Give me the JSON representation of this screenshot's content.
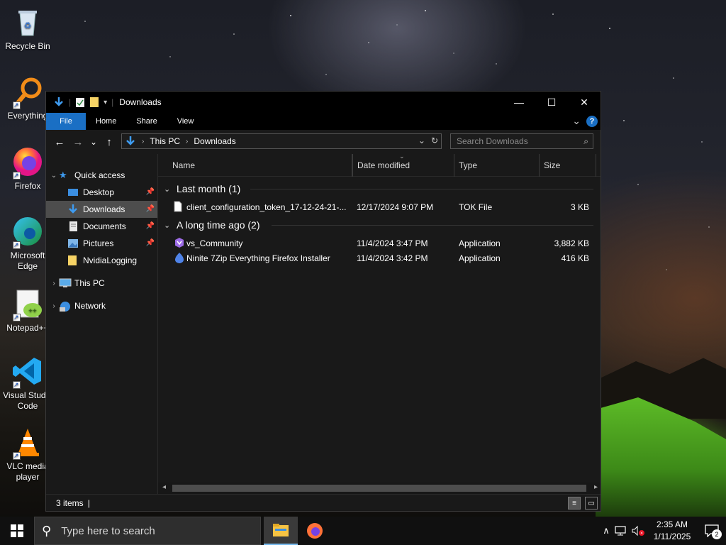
{
  "desktop": {
    "icons": [
      {
        "label": "Recycle Bin",
        "icon": "recycle-bin-icon"
      },
      {
        "label": "Everything",
        "icon": "everything-search-icon"
      },
      {
        "label": "Firefox",
        "icon": "firefox-icon"
      },
      {
        "label": "Microsoft\nEdge",
        "icon": "edge-icon"
      },
      {
        "label": "Notepad++",
        "icon": "notepad-plus-plus-icon"
      },
      {
        "label": "Visual Studio\nCode",
        "icon": "vscode-icon"
      },
      {
        "label": "VLC media\nplayer",
        "icon": "vlc-icon"
      }
    ]
  },
  "window": {
    "title": "Downloads",
    "controls": {
      "minimize": "—",
      "maximize": "☐",
      "close": "✕"
    },
    "ribbon": {
      "tabs": [
        "File",
        "Home",
        "Share",
        "View"
      ],
      "expand": "⌄",
      "help": "?"
    },
    "nav": {
      "back": "←",
      "forward": "→",
      "recent": "⌄",
      "up": "↑",
      "breadcrumb": [
        "This PC",
        "Downloads"
      ],
      "dropdown": "⌄",
      "refresh": "↻",
      "search_placeholder": "Search Downloads",
      "search_icon": "⌕"
    },
    "navpane": {
      "quick_access": "Quick access",
      "pinned": [
        {
          "label": "Desktop",
          "icon": "desktop-folder-icon",
          "pinned": true
        },
        {
          "label": "Downloads",
          "icon": "downloads-folder-icon",
          "pinned": true,
          "selected": true
        },
        {
          "label": "Documents",
          "icon": "documents-folder-icon",
          "pinned": true
        },
        {
          "label": "Pictures",
          "icon": "pictures-folder-icon",
          "pinned": true
        },
        {
          "label": "NvidiaLogging",
          "icon": "folder-icon",
          "pinned": false
        }
      ],
      "this_pc": "This PC",
      "network": "Network"
    },
    "columns": {
      "name": "Name",
      "date": "Date modified",
      "type": "Type",
      "size": "Size"
    },
    "groups": [
      {
        "title": "Last month (1)",
        "files": [
          {
            "name": "client_configuration_token_17-12-24-21-...",
            "date": "12/17/2024 9:07 PM",
            "type": "TOK File",
            "size": "3 KB",
            "icon": "generic-file-icon"
          }
        ]
      },
      {
        "title": "A long time ago (2)",
        "files": [
          {
            "name": "vs_Community",
            "date": "11/4/2024 3:47 PM",
            "type": "Application",
            "size": "3,882 KB",
            "icon": "visual-studio-installer-icon"
          },
          {
            "name": "Ninite 7Zip Everything Firefox Installer",
            "date": "11/4/2024 3:42 PM",
            "type": "Application",
            "size": "416 KB",
            "icon": "ninite-icon"
          }
        ]
      }
    ],
    "status": {
      "items": "3 items",
      "cursor": "|"
    }
  },
  "taskbar": {
    "search_placeholder": "Type here to search",
    "clock_time": "2:35 AM",
    "clock_date": "1/11/2025",
    "notification_count": "2",
    "tray_chevron": "∧"
  },
  "colors": {
    "accent": "#1a6fc4",
    "window_bg": "#191919",
    "titlebar": "#000000",
    "selection": "#4d4d4d"
  }
}
